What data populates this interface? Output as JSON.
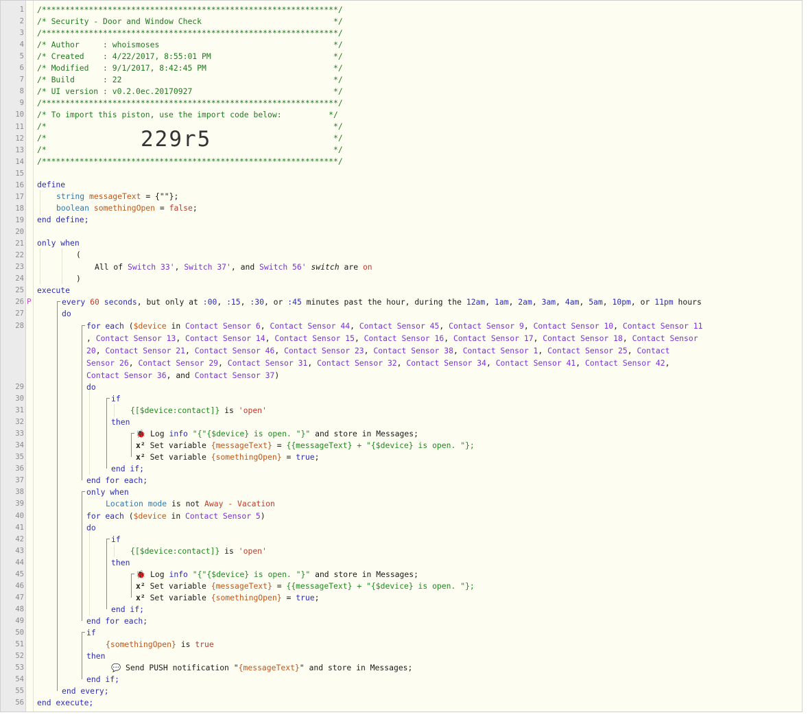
{
  "piston_code": "229r5",
  "header_lines": [
    "/***************************************************************/",
    "/* Security - Door and Window Check                            */",
    "/***************************************************************/",
    "/* Author     : whoismoses                                     */",
    "/* Created    : 4/22/2017, 8:55:01 PM                          */",
    "/* Modified   : 9/1/2017, 8:42:45 PM                           */",
    "/* Build      : 22                                             */",
    "/* UI version : v0.2.0ec.20170927                              */",
    "/***************************************************************/",
    "/* To import this piston, use the import code below:          */",
    "/*                                                             */",
    "/*                                                             */",
    "/*                                                             */",
    "/***************************************************************/"
  ],
  "define": {
    "open": "define",
    "close": "end define;",
    "var1_type": "string",
    "var1_name": "messageText",
    "var1_init": "= {\"\"};",
    "var2_type": "boolean",
    "var2_name": "somethingOpen",
    "var2_eq": "=",
    "var2_val": "false",
    "var2_end": ";"
  },
  "only_when": {
    "only": "only",
    "when": "when",
    "paren_open": "(",
    "paren_close": ")",
    "all_of": "All of",
    "sw1": "Switch 33'",
    "sw2": "Switch 37'",
    "sw3": "Switch 56'",
    "attr": "switch",
    "are": "are",
    "value": "on"
  },
  "execute": {
    "open": "execute",
    "close": "end execute;",
    "every_line": {
      "every": "every",
      "secs": "60",
      "seconds": "seconds",
      "but": ", but only at",
      "m1": ":00",
      "m2": ":15",
      "m3": ":30",
      "m4": ":45",
      "or": "or",
      "past": "minutes past the hour, during the",
      "h1": "12am",
      "h2": "1am",
      "h3": "2am",
      "h4": "3am",
      "h5": "4am",
      "h6": "5am",
      "h7": "10pm",
      "h8": "11pm",
      "hours": "hours"
    },
    "do": "do",
    "end_every": "end every;"
  },
  "for_each_1": {
    "for_each": "for each",
    "var": "$device",
    "in": "in",
    "line_a": [
      "Contact Sensor 6",
      "Contact Sensor 44",
      "Contact Sensor 45",
      "Contact Sensor 9",
      "Contact Sensor 10",
      "Contact Sensor 11"
    ],
    "line_b": [
      "Contact Sensor 13",
      "Contact Sensor 14",
      "Contact Sensor 15",
      "Contact Sensor 16",
      "Contact Sensor 17",
      "Contact Sensor 18",
      "Contact Sensor"
    ],
    "line_c": [
      "20",
      "Contact Sensor 21",
      "Contact Sensor 46",
      "Contact Sensor 23",
      "Contact Sensor 38",
      "Contact Sensor 1",
      "Contact Sensor 25",
      "Contact"
    ],
    "line_d": [
      "Sensor 26",
      "Contact Sensor 29",
      "Contact Sensor 31",
      "Contact Sensor 32",
      "Contact Sensor 34",
      "Contact Sensor 41",
      "Contact Sensor 42"
    ],
    "line_e": [
      "Contact Sensor 36",
      "Contact Sensor 37"
    ],
    "and": "and",
    "do": "do",
    "end": "end for each;"
  },
  "if_block": {
    "if": "if",
    "cond": "{[$device:contact]}",
    "is": "is",
    "open_val": "'open'",
    "then": "then",
    "log_icon": "🐞",
    "log": "Log",
    "level": "info",
    "log_str_a": "\"{\"{$device} is open. \"}\"",
    "log_tail": "and store in Messages;",
    "x2": "x²",
    "set": "Set variable",
    "v1": "{messageText}",
    "eq": "=",
    "expr_a": "{{messageText} +",
    "expr_b": "\"{$device} is open. \"};",
    "v2": "{somethingOpen}",
    "true": "true",
    "semi": ";",
    "end": "end if;"
  },
  "only_when_2": {
    "only": "only when",
    "loc": "Location mode",
    "is_not": "is not",
    "mode": "Away - Vacation",
    "for_each": "for each",
    "var": "$device",
    "in": "in",
    "dev": "Contact Sensor 5",
    "do": "do",
    "end": "end for each;"
  },
  "final_if": {
    "if": "if",
    "v": "{somethingOpen}",
    "is": "is",
    "val": "true",
    "then": "then",
    "icon": "💬",
    "send": "Send PUSH notification",
    "q1": "\"",
    "msg": "{messageText}",
    "q2": "\"",
    "tail": "and store in Messages;",
    "end": "end if;"
  },
  "line_numbers": [
    "1",
    "2",
    "3",
    "4",
    "5",
    "6",
    "7",
    "8",
    "9",
    "10",
    "11",
    "12",
    "13",
    "14",
    "15",
    "16",
    "17",
    "18",
    "19",
    "20",
    "21",
    "22",
    "23",
    "24",
    "25",
    "26",
    "27",
    "28",
    "29",
    "30",
    "31",
    "32",
    "33",
    "34",
    "35",
    "36",
    "37",
    "38",
    "39",
    "40",
    "41",
    "42",
    "43",
    "44",
    "45",
    "46",
    "47",
    "48",
    "49",
    "50",
    "51",
    "52",
    "53",
    "54",
    "55",
    "56"
  ],
  "colors": {
    "background": "#fdfdf1",
    "gutter": "#ebebeb",
    "comment": "#1f7a1f",
    "keyword": "#2b2bb5",
    "device": "#7a32d8",
    "variable": "#c0561b",
    "value": "#c0392b"
  },
  "marker": "P"
}
